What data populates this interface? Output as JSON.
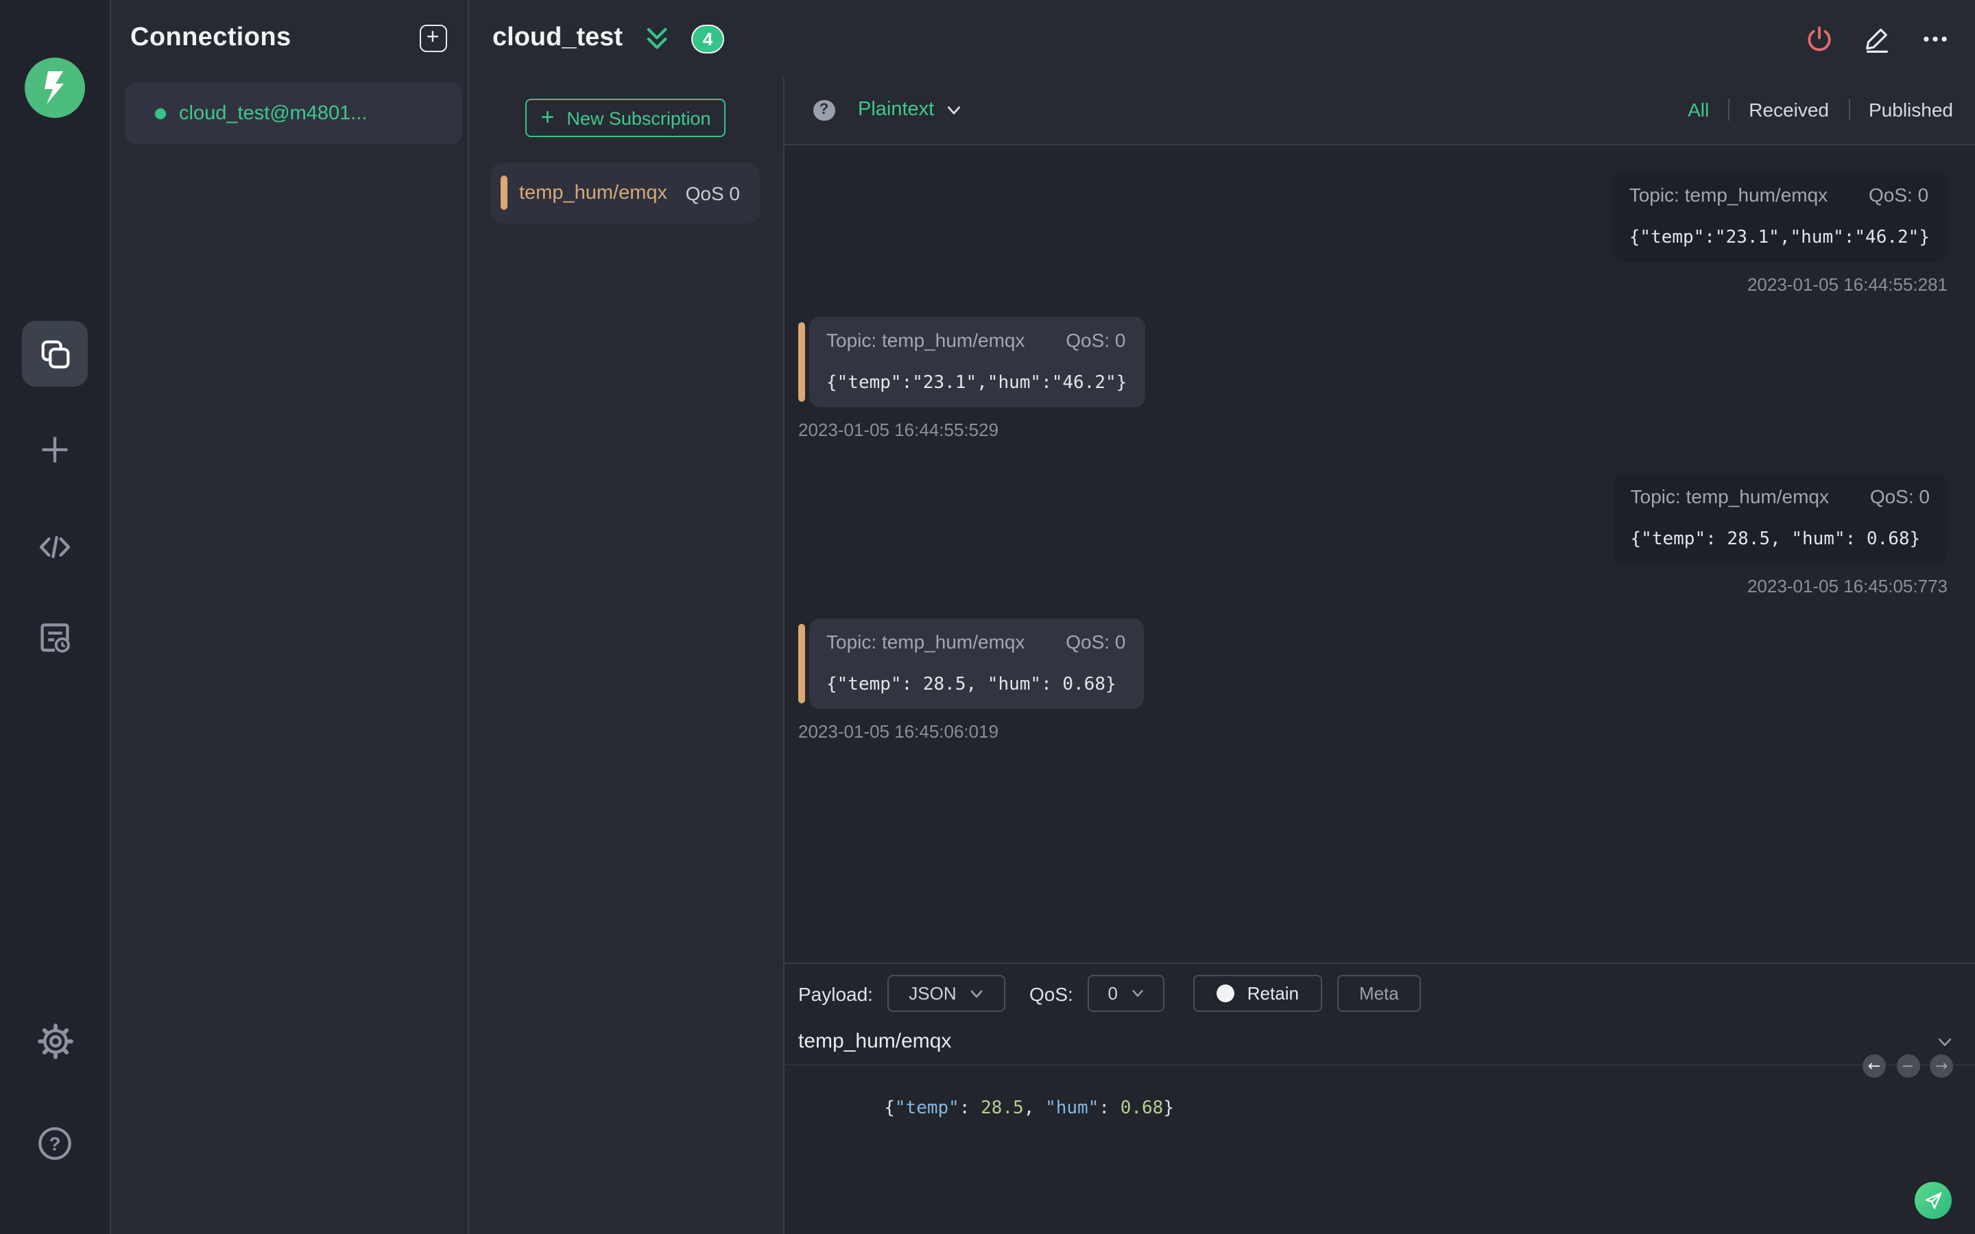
{
  "colors": {
    "accent_green": "#34c388",
    "marker_orange": "#d9a873",
    "power_red": "#e56c6c"
  },
  "connections_panel": {
    "title": "Connections",
    "items": [
      {
        "label": "cloud_test@m4801..."
      }
    ]
  },
  "main_header": {
    "connection_name": "cloud_test",
    "message_count": "4"
  },
  "subscriptions": {
    "new_subscription_label": "New Subscription",
    "items": [
      {
        "topic": "temp_hum/emqx",
        "qos": "QoS 0"
      }
    ]
  },
  "messages_toolbar": {
    "format": "Plaintext",
    "filters": {
      "all": "All",
      "received": "Received",
      "published": "Published"
    }
  },
  "messages": {
    "labels": {
      "topic": "Topic:",
      "qos": "QoS:"
    },
    "items": [
      {
        "direction": "published",
        "topic": "temp_hum/emqx",
        "qos": "0",
        "payload": "{\"temp\":\"23.1\",\"hum\":\"46.2\"}",
        "timestamp": "2023-01-05 16:44:55:281"
      },
      {
        "direction": "received",
        "topic": "temp_hum/emqx",
        "qos": "0",
        "payload": "{\"temp\":\"23.1\",\"hum\":\"46.2\"}",
        "timestamp": "2023-01-05 16:44:55:529"
      },
      {
        "direction": "published",
        "topic": "temp_hum/emqx",
        "qos": "0",
        "payload": "{\"temp\": 28.5, \"hum\": 0.68}",
        "timestamp": "2023-01-05 16:45:05:773"
      },
      {
        "direction": "received",
        "topic": "temp_hum/emqx",
        "qos": "0",
        "payload": "{\"temp\": 28.5, \"hum\": 0.68}",
        "timestamp": "2023-01-05 16:45:06:019"
      }
    ]
  },
  "publish": {
    "payload_label": "Payload:",
    "format": "JSON",
    "qos_label": "QoS:",
    "qos": "0",
    "retain_label": "Retain",
    "meta_label": "Meta",
    "topic": "temp_hum/emqx",
    "payload_tokens": [
      [
        "{",
        "p"
      ],
      [
        "\"temp\"",
        "k"
      ],
      [
        ": ",
        "p"
      ],
      [
        "28.5",
        "n"
      ],
      [
        ", ",
        "p"
      ],
      [
        "\"hum\"",
        "k"
      ],
      [
        ": ",
        "p"
      ],
      [
        "0.68",
        "n"
      ],
      [
        "}",
        "p"
      ]
    ]
  }
}
